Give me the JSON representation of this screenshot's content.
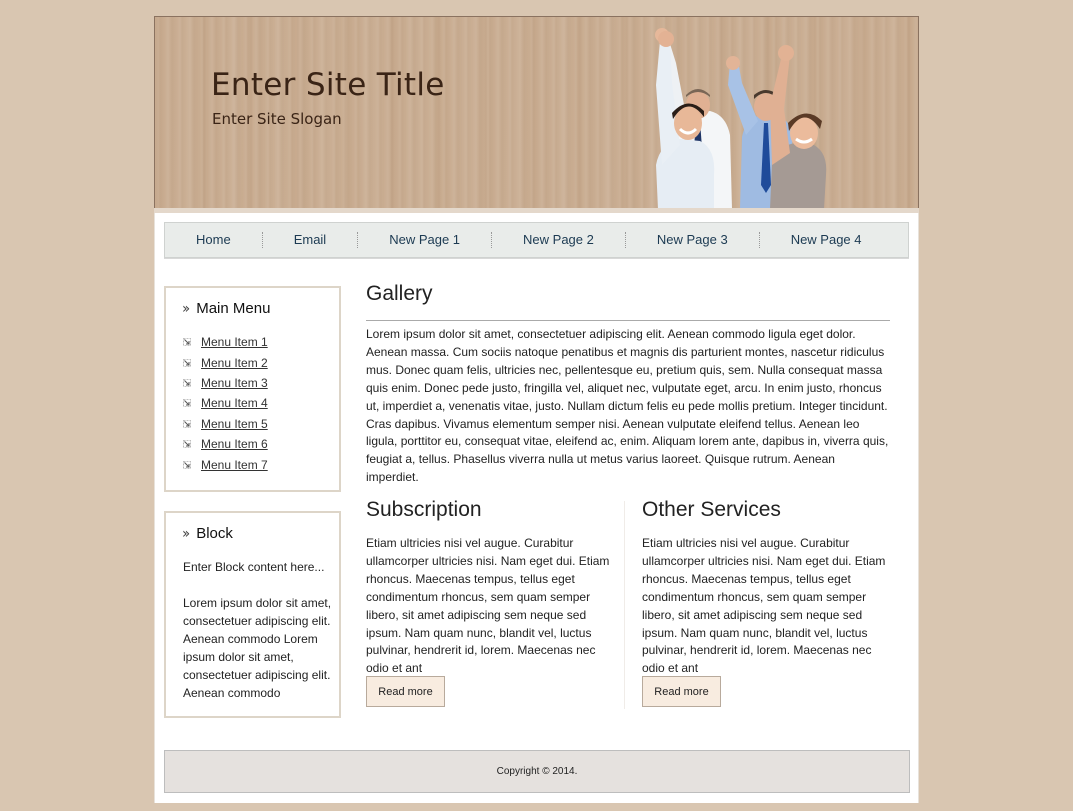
{
  "header": {
    "site_title": "Enter Site Title",
    "site_slogan": "Enter Site Slogan",
    "photo_alt": "group-of-cheering-business-people"
  },
  "nav": {
    "items": [
      {
        "label": "Home"
      },
      {
        "label": "Email"
      },
      {
        "label": "New Page 1"
      },
      {
        "label": "New Page 2"
      },
      {
        "label": "New Page 3"
      },
      {
        "label": "New Page 4"
      }
    ]
  },
  "sidebar": {
    "main_menu": {
      "title": "Main Menu",
      "icon": "double-chevron-right-icon",
      "bullet_icon": "arrow-down-right-icon",
      "items": [
        {
          "label": "Menu Item 1"
        },
        {
          "label": "Menu Item 2"
        },
        {
          "label": "Menu Item 3"
        },
        {
          "label": "Menu Item 4"
        },
        {
          "label": "Menu Item 5"
        },
        {
          "label": "Menu Item 6"
        },
        {
          "label": "Menu Item 7"
        }
      ]
    },
    "block": {
      "title": "Block",
      "icon": "double-chevron-right-icon",
      "intro": "Enter Block content here...",
      "body": "Lorem ipsum dolor sit amet, consectetuer adipiscing elit. Aenean commodo Lorem ipsum dolor sit amet, consectetuer adipiscing elit. Aenean commodo"
    }
  },
  "main": {
    "gallery": {
      "title": "Gallery",
      "text": "Lorem ipsum dolor sit amet, consectetuer adipiscing elit. Aenean commodo ligula eget dolor. Aenean massa. Cum sociis natoque penatibus et magnis dis parturient montes, nascetur ridiculus mus. Donec quam felis, ultricies nec, pellentesque eu, pretium quis, sem. Nulla consequat massa quis enim. Donec pede justo, fringilla vel, aliquet nec, vulputate eget, arcu. In enim justo, rhoncus ut, imperdiet a, venenatis vitae, justo. Nullam dictum felis eu pede mollis pretium. Integer tincidunt. Cras dapibus. Vivamus elementum semper nisi. Aenean vulputate eleifend tellus. Aenean leo ligula, porttitor eu, consequat vitae, eleifend ac, enim. Aliquam lorem ante, dapibus in, viverra quis, feugiat a, tellus. Phasellus viverra nulla ut metus varius laoreet. Quisque rutrum. Aenean imperdiet."
    },
    "subscription": {
      "title": "Subscription",
      "text": "Etiam ultricies nisi vel augue. Curabitur ullamcorper ultricies nisi. Nam eget dui. Etiam rhoncus. Maecenas tempus, tellus eget condimentum rhoncus, sem quam semper libero, sit amet adipiscing sem neque sed ipsum. Nam quam nunc, blandit vel, luctus pulvinar, hendrerit id, lorem. Maecenas nec odio et ant",
      "button_label": "Read more"
    },
    "other_services": {
      "title": "Other Services",
      "text": "Etiam ultricies nisi vel augue. Curabitur ullamcorper ultricies nisi. Nam eget dui. Etiam rhoncus. Maecenas tempus, tellus eget condimentum rhoncus, sem quam semper libero, sit amet adipiscing sem neque sed ipsum. Nam quam nunc, blandit vel, luctus pulvinar, hendrerit id, lorem. Maecenas nec odio et ant",
      "button_label": "Read more"
    }
  },
  "footer": {
    "copyright": "Copyright © 2014."
  },
  "colors": {
    "page_bg": "#d9c6b1",
    "header_bg": "#c8ab8f",
    "title_color": "#3a2416",
    "nav_bg": "#e9ecea",
    "nav_text": "#1c3a52",
    "button_bg": "#f8ece0",
    "footer_bg": "#e5e1de"
  }
}
